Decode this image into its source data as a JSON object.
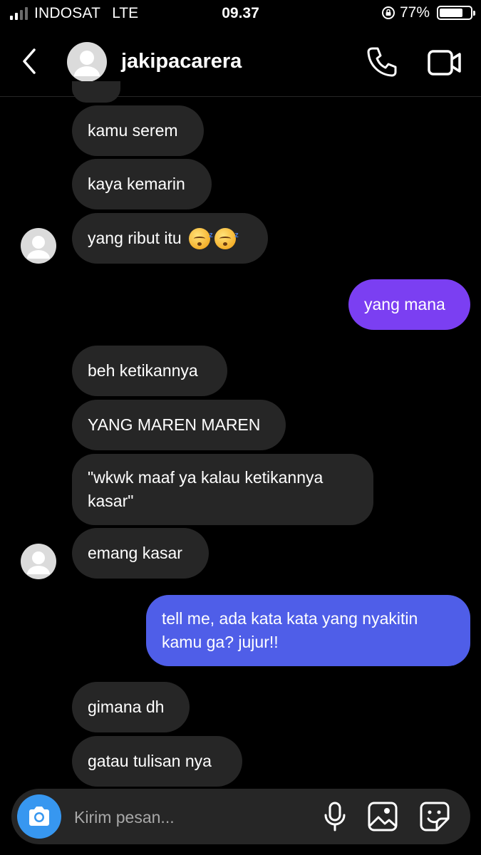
{
  "status_bar": {
    "carrier": "INDOSAT",
    "network": "LTE",
    "time": "09.37",
    "battery": "77%",
    "battery_level": 0.77
  },
  "header": {
    "username": "jakipacarera",
    "icons": [
      "back-icon",
      "call-icon",
      "video-call-icon"
    ]
  },
  "messages": [
    {
      "from": "them",
      "text": "kamu serem"
    },
    {
      "from": "them",
      "text": "kaya kemarin"
    },
    {
      "from": "them",
      "text": "yang ribut itu",
      "emoji": "sleeping-face x2"
    },
    {
      "from": "me",
      "text": "yang mana"
    },
    {
      "from": "them",
      "text": "beh ketikannya"
    },
    {
      "from": "them",
      "text": "YANG MAREN MAREN"
    },
    {
      "from": "them",
      "text": "\"wkwk maaf ya kalau ketikannya kasar\""
    },
    {
      "from": "them",
      "text": "emang kasar"
    },
    {
      "from": "me",
      "text": "tell me, ada kata kata yang nyakitin kamu ga? jujur!!"
    },
    {
      "from": "them",
      "text": "gimana dh"
    },
    {
      "from": "them",
      "text": "gatau tulisan nya"
    }
  ],
  "composer": {
    "placeholder": "Kirim pesan...",
    "icons": [
      "camera-icon",
      "microphone-icon",
      "gallery-icon",
      "sticker-icon"
    ]
  },
  "colors": {
    "background": "#000000",
    "incoming_bubble": "#262626",
    "outgoing_purple": "#7b3ff2",
    "outgoing_blue": "#4f5ee8",
    "camera_button": "#3797f0"
  }
}
